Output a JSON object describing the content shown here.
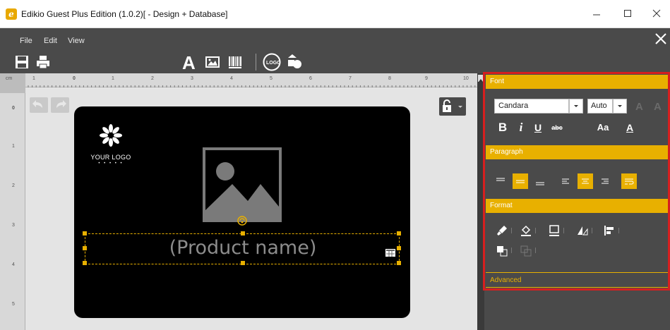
{
  "window": {
    "app_icon_letter": "e",
    "title": "Edikio Guest Plus Edition (1.0.2)[ - Design + Database]"
  },
  "menu": {
    "items": [
      "File",
      "Edit",
      "View"
    ]
  },
  "ruler": {
    "unit": "cm",
    "top_numbers": [
      "1",
      "0",
      "1",
      "2",
      "3",
      "4",
      "5",
      "6",
      "7",
      "8",
      "9",
      "10"
    ],
    "left_numbers": [
      "0",
      "1",
      "2",
      "3",
      "4",
      "5"
    ]
  },
  "label": {
    "logo_text": "YOUR LOGO",
    "logo_dots": "• • • • •",
    "product_field": "(Product name)"
  },
  "panel": {
    "font_header": "Font",
    "font_name": "Candara",
    "font_size": "Auto",
    "bold": "B",
    "italic": "i",
    "underline": "U",
    "strike": "abc",
    "case": "Aa",
    "color": "A",
    "paragraph_header": "Paragraph",
    "format_header": "Format",
    "advanced_header": "Advanced"
  },
  "colors": {
    "accent": "#e8b000",
    "highlight_border": "#d61f1f",
    "panel_bg": "#4a4a4a",
    "canvas_bg": "#000000"
  }
}
